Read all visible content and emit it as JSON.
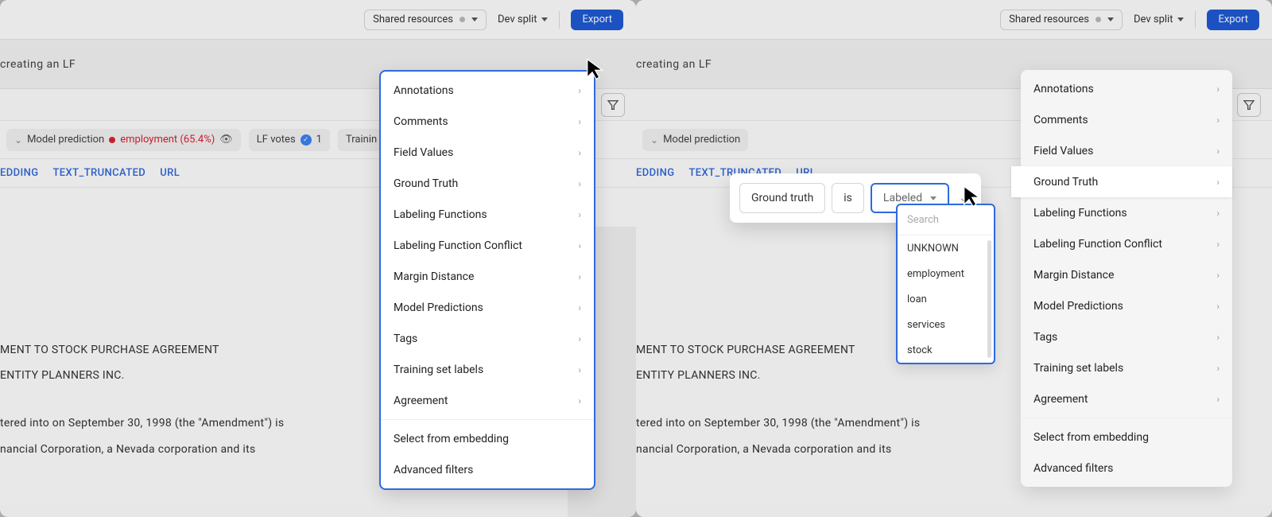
{
  "topbar": {
    "resources_label": "Shared resources",
    "devsplit_label": "Dev split",
    "export_label": "Export"
  },
  "subrow": {
    "text": "creating an LF"
  },
  "tagsrow": {
    "model_pred_label": "Model prediction",
    "model_pred_value": "employment (65.4%)",
    "lf_votes_label": "LF votes",
    "lf_votes_count": "1",
    "training_label": "Trainin"
  },
  "bluelinks": {
    "a": "EDDING",
    "b": "TEXT_TRUNCATED",
    "c": "URL"
  },
  "body": {
    "l1": "MENT TO STOCK PURCHASE AGREEMENT",
    "l2": " ENTITY PLANNERS INC.",
    "l3": "tered into on September 30, 1998 (the \"Amendment\") is",
    "l4": "nancial  Corporation,  a Nevada  corporation  and its"
  },
  "popover": {
    "items": [
      "Annotations",
      "Comments",
      "Field Values",
      "Ground Truth",
      "Labeling Functions",
      "Labeling Function Conflict",
      "Margin Distance",
      "Model Predictions",
      "Tags",
      "Training set labels",
      "Agreement"
    ],
    "embed": "Select from embedding",
    "advanced": "Advanced filters"
  },
  "tokens": {
    "gt": "Ground truth",
    "is": "is",
    "labeled": "Labeled"
  },
  "dropdown": {
    "search_placeholder": "Search",
    "opts": [
      "UNKNOWN",
      "employment",
      "loan",
      "services",
      "stock"
    ]
  }
}
